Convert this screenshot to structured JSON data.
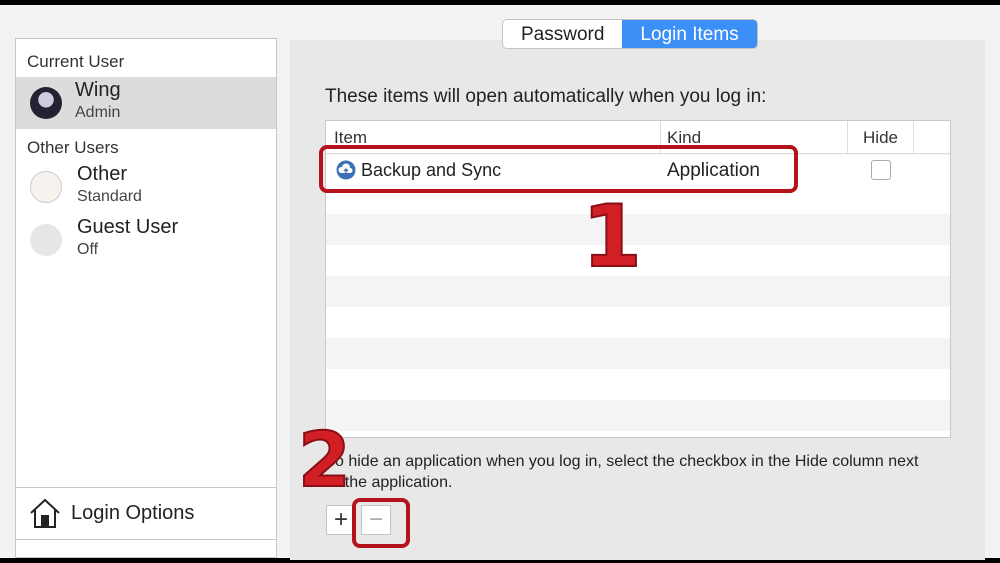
{
  "sidebar": {
    "current_user_header": "Current User",
    "current_user": {
      "name": "Wing",
      "role": "Admin"
    },
    "other_users_header": "Other Users",
    "other_users": [
      {
        "name": "Other",
        "role": "Standard"
      },
      {
        "name": "Guest User",
        "role": "Off"
      }
    ],
    "login_options": "Login Options"
  },
  "tabs": [
    {
      "label": "Password",
      "active": false
    },
    {
      "label": "Login Items",
      "active": true
    }
  ],
  "main": {
    "intro": "These items will open automatically when you log in:",
    "columns": [
      "Item",
      "Kind",
      "Hide"
    ],
    "rows": [
      {
        "item": "Backup and Sync",
        "kind": "Application",
        "hide": false,
        "icon": "cloud-upload-icon"
      }
    ],
    "help": "To hide an application when you log in, select the checkbox in the Hide column next to the application.",
    "add_label": "+",
    "remove_label": "−"
  },
  "annotations": [
    "1",
    "2"
  ],
  "colors": {
    "accent": "#3c8ff7",
    "annotation": "#d21f26"
  }
}
